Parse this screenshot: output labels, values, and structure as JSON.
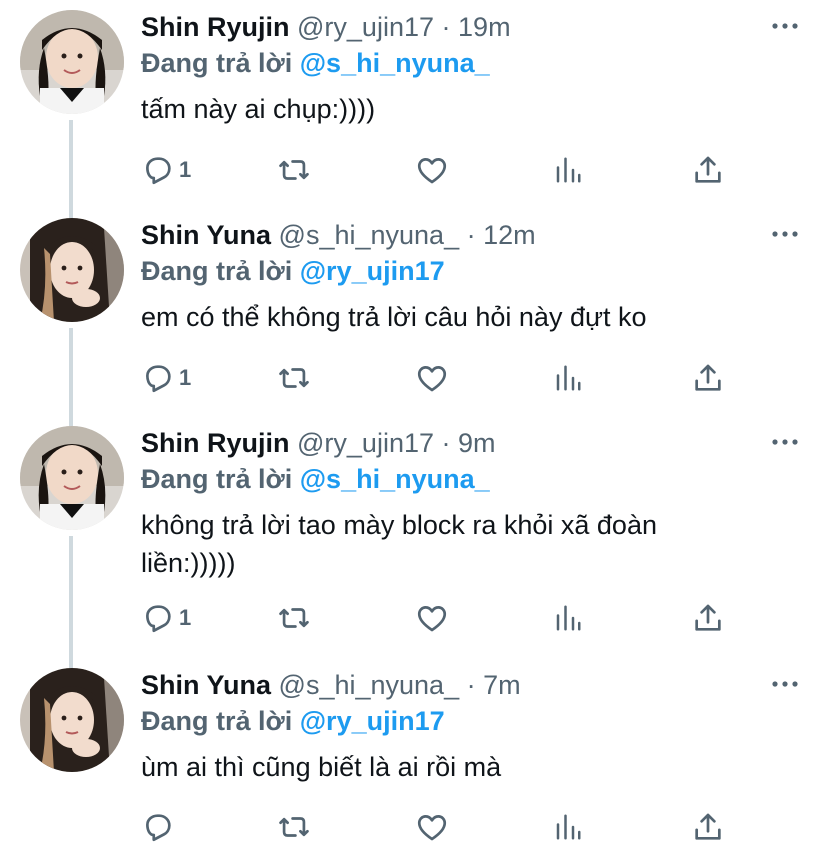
{
  "colors": {
    "accent": "#1d9bf0",
    "secondary_text": "#536471",
    "primary_text": "#0f1419",
    "thread_line": "#cfd9de"
  },
  "reply_prefix": "Đang trả lời",
  "tweets": [
    {
      "name": "Shin Ryujin",
      "handle": "@ry_ujin17",
      "dot": "·",
      "time": "19m",
      "reply_to": "@s_hi_nyuna_",
      "text": "tấm này ai chụp:))))",
      "reply_count": "1",
      "avatar_icon": "avatar-ryujin"
    },
    {
      "name": "Shin Yuna",
      "handle": "@s_hi_nyuna_",
      "dot": "·",
      "time": "12m",
      "reply_to": "@ry_ujin17",
      "text": "em có thể không trả lời câu hỏi này đựt ko",
      "reply_count": "1",
      "avatar_icon": "avatar-yuna"
    },
    {
      "name": "Shin Ryujin",
      "handle": "@ry_ujin17",
      "dot": "·",
      "time": "9m",
      "reply_to": "@s_hi_nyuna_",
      "text": "không trả lời tao mày block ra khỏi xã đoàn liền:)))))",
      "reply_count": "1",
      "avatar_icon": "avatar-ryujin"
    },
    {
      "name": "Shin Yuna",
      "handle": "@s_hi_nyuna_",
      "dot": "·",
      "time": "7m",
      "reply_to": "@ry_ujin17",
      "text": "ùm ai thì cũng biết là ai rồi mà",
      "reply_count": "",
      "avatar_icon": "avatar-yuna"
    }
  ],
  "action_icons": [
    "reply-icon",
    "retweet-icon",
    "like-icon",
    "analytics-icon",
    "share-icon"
  ]
}
